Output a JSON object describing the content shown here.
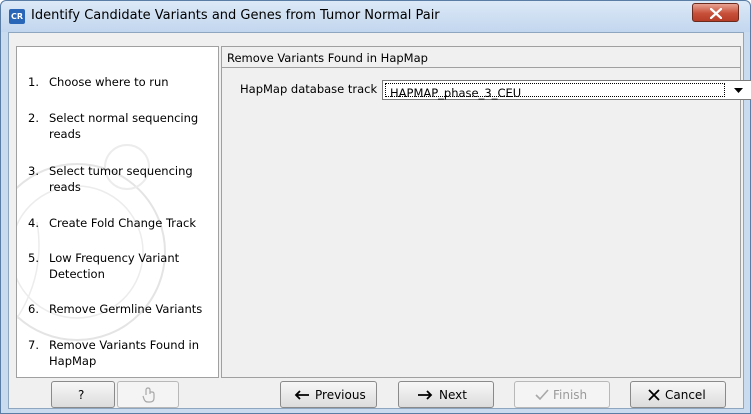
{
  "window": {
    "app_icon_text": "CR",
    "title": "Identify Candidate Variants and Genes from Tumor Normal Pair"
  },
  "steps": [
    {
      "num": "1.",
      "label": "Choose where to run"
    },
    {
      "num": "2.",
      "label": "Select normal sequencing reads"
    },
    {
      "num": "3.",
      "label": "Select tumor sequencing reads"
    },
    {
      "num": "4.",
      "label": "Create Fold Change Track"
    },
    {
      "num": "5.",
      "label": "Low Frequency Variant Detection"
    },
    {
      "num": "6.",
      "label": "Remove Germline Variants"
    },
    {
      "num": "7.",
      "label": "Remove Variants Found in HapMap"
    }
  ],
  "section": {
    "title": "Remove Variants Found in HapMap",
    "field_label": "HapMap database track",
    "field_value": "HAPMAP_phase_3_CEU"
  },
  "buttons": {
    "help": "?",
    "previous": "Previous",
    "next": "Next",
    "finish": "Finish",
    "cancel": "Cancel"
  }
}
